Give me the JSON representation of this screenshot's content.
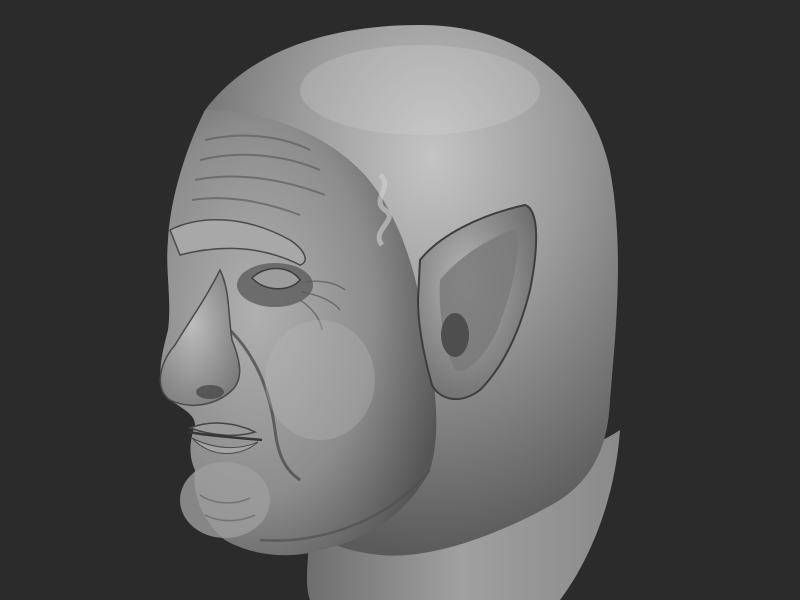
{
  "viewport": {
    "background_color": "#2b2b2b",
    "model": {
      "icon": "sculpted-head-model",
      "material_base_color": "#8a8a8a",
      "material_highlight_color": "#c9c9c9",
      "material_shadow_color": "#3a3a3a"
    }
  }
}
